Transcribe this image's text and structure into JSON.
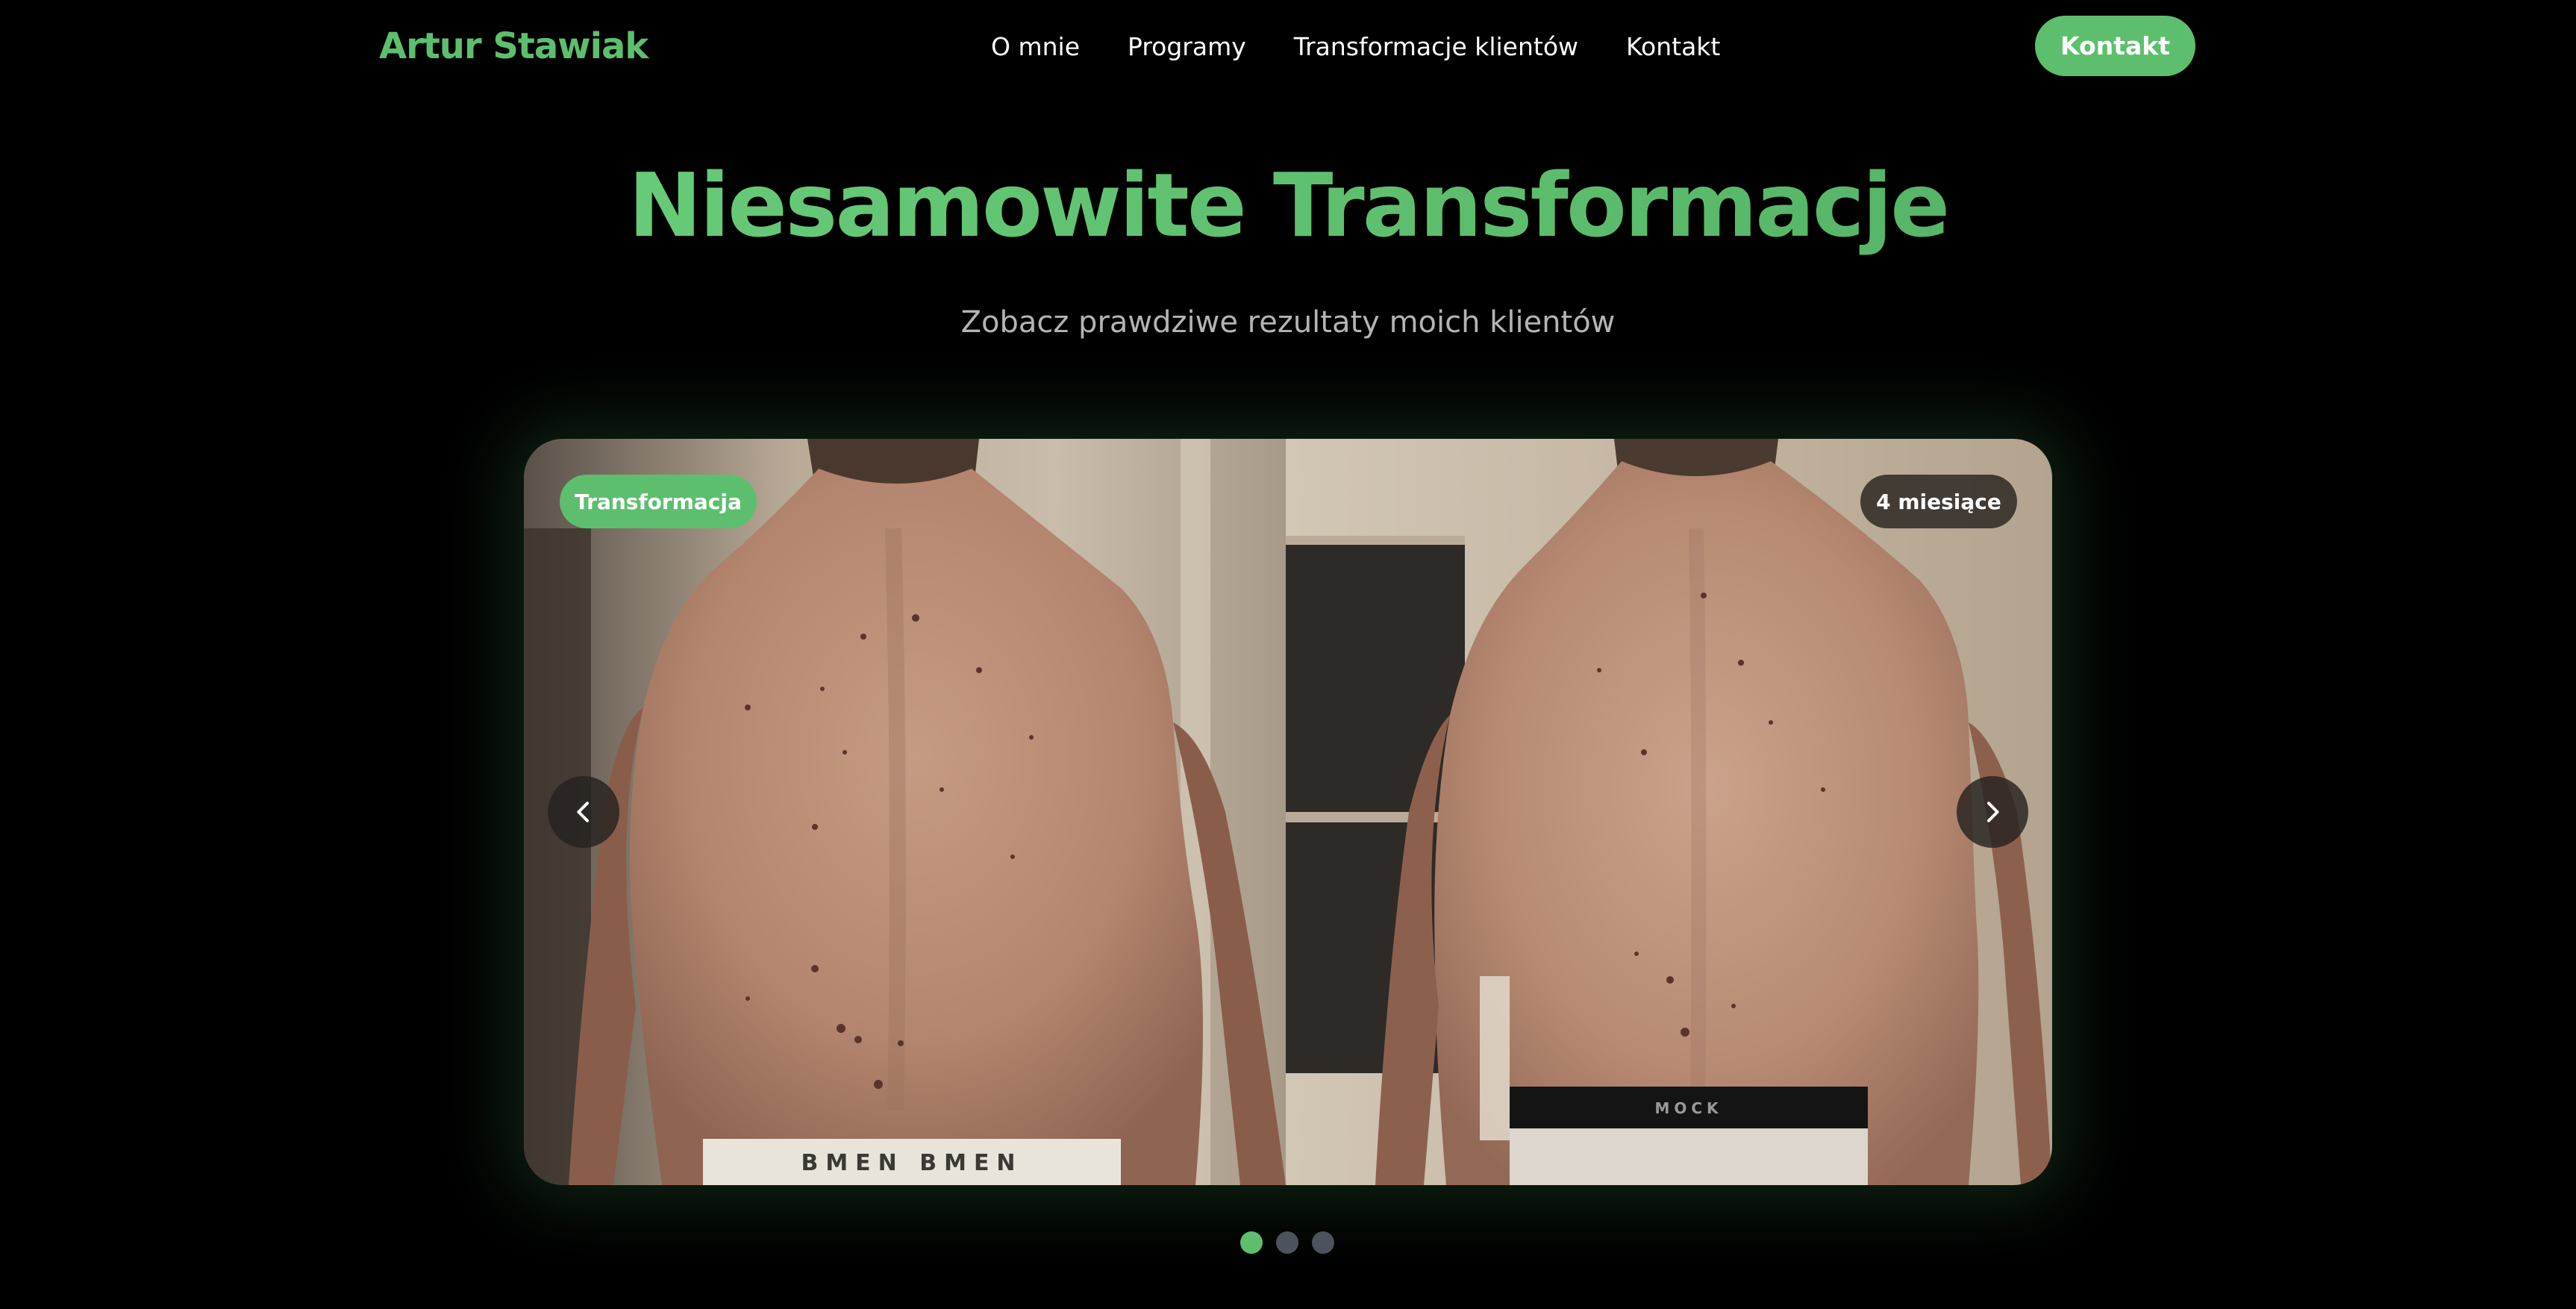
{
  "header": {
    "brand": "Artur Stawiak",
    "nav": [
      "O mnie",
      "Programy",
      "Transformacje klientów",
      "Kontakt"
    ],
    "cta_label": "Kontakt"
  },
  "hero": {
    "title": "Niesamowite Transformacje",
    "subtitle": "Zobacz prawdziwe rezultaty moich klientów"
  },
  "carousel": {
    "tag_label": "Transformacja",
    "duration_label": "4 miesiące",
    "before_waistband_text": "BMEN     BMEN",
    "after_waistband_text": "MOCK",
    "prev_icon": "chevron-left-icon",
    "next_icon": "chevron-right-icon",
    "slide_count": 3,
    "active_slide": 1
  },
  "colors": {
    "accent": "#5dbf6e",
    "background": "#000000",
    "subtitle": "#b4b4b4",
    "dot_inactive": "#4c535c"
  }
}
